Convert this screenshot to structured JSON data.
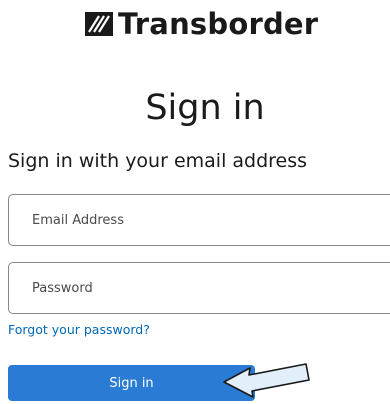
{
  "brand": {
    "name": "Transborder",
    "logo_icon": "slashed-square-logo-icon"
  },
  "page": {
    "title": "Sign in",
    "subtitle": "Sign in with your email address"
  },
  "form": {
    "email_placeholder": "Email Address",
    "password_placeholder": "Password",
    "forgot_link": "Forgot your password?",
    "submit_label": "Sign in"
  },
  "annotation": {
    "icon": "pointer-arrow-icon"
  },
  "colors": {
    "link": "#0067b8",
    "button": "#2a7bd4",
    "arrow_fill": "#e3eefb"
  }
}
